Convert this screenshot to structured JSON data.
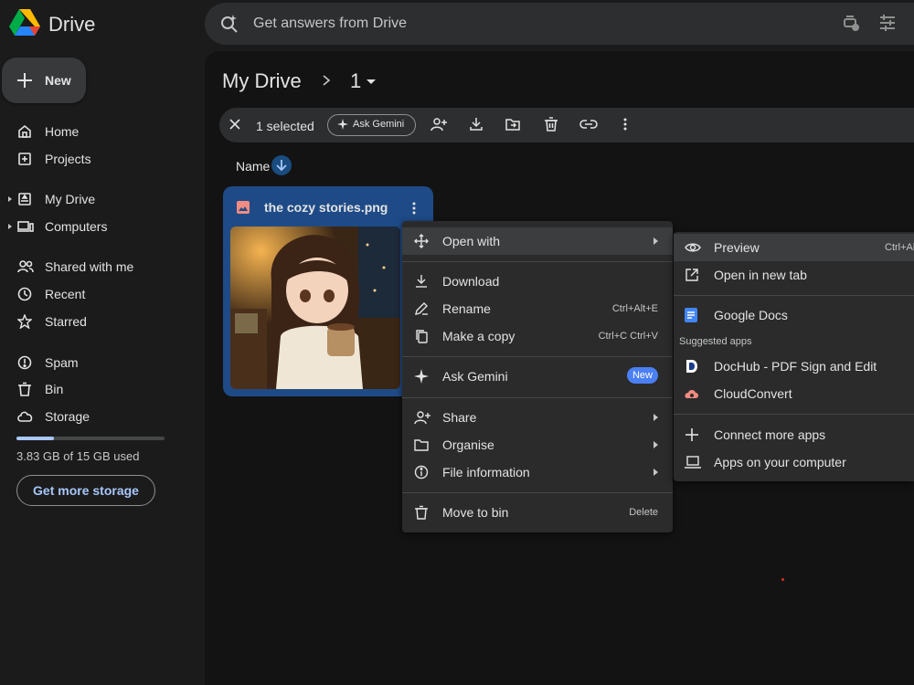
{
  "app": {
    "brand": "Drive"
  },
  "search": {
    "placeholder": "Get answers from Drive"
  },
  "sidebar": {
    "new_label": "New",
    "items": [
      {
        "label": "Home"
      },
      {
        "label": "Projects"
      },
      {
        "label": "My Drive"
      },
      {
        "label": "Computers"
      },
      {
        "label": "Shared with me"
      },
      {
        "label": "Recent"
      },
      {
        "label": "Starred"
      },
      {
        "label": "Spam"
      },
      {
        "label": "Bin"
      },
      {
        "label": "Storage"
      }
    ],
    "storage": {
      "used_text": "3.83 GB of 15 GB used",
      "used_fraction": 0.255,
      "button_label": "Get more storage"
    }
  },
  "breadcrumb": {
    "root": "My Drive",
    "folder": "1"
  },
  "selection_bar": {
    "count_text": "1 selected",
    "gemini_label": "Ask Gemini"
  },
  "list_header": {
    "name_label": "Name"
  },
  "file": {
    "name": "the cozy stories.png"
  },
  "context_menu": {
    "open_with": "Open with",
    "download": "Download",
    "rename": "Rename",
    "rename_shortcut": "Ctrl+Alt+E",
    "make_copy": "Make a copy",
    "make_copy_shortcut": "Ctrl+C Ctrl+V",
    "ask_gemini": "Ask Gemini",
    "new_badge": "New",
    "share": "Share",
    "organise": "Organise",
    "file_information": "File information",
    "move_to_bin": "Move to bin",
    "move_to_bin_shortcut": "Delete"
  },
  "open_with_menu": {
    "preview": "Preview",
    "preview_shortcut": "Ctrl+Alt+P",
    "open_new_tab": "Open in new tab",
    "google_docs": "Google Docs",
    "suggested_apps": "Suggested apps",
    "dochub": "DocHub - PDF Sign and Edit",
    "cloudconvert": "CloudConvert",
    "connect_more": "Connect more apps",
    "apps_on_computer": "Apps on your computer"
  },
  "colors": {
    "accent": "#a8c7fa",
    "selected_card": "#1e4b87",
    "new_badge": "#4b7ff4"
  }
}
